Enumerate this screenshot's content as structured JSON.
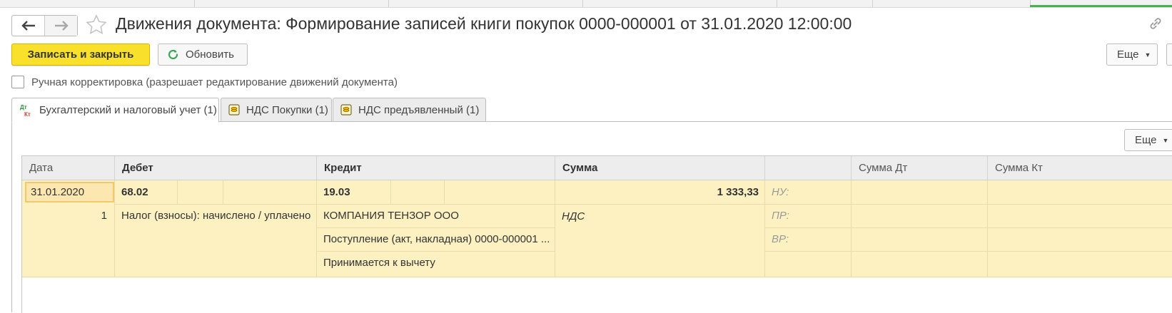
{
  "window": {
    "title": "Движения документа: Формирование записей книги покупок 0000-000001 от 31.01.2020 12:00:00"
  },
  "toolbar": {
    "save_close_label": "Записать и закрыть",
    "refresh_label": "Обновить",
    "more_label": "Еще"
  },
  "manual_edit": {
    "label": "Ручная корректировка (разрешает редактирование движений документа)",
    "checked": false
  },
  "tabs": [
    {
      "label": "Бухгалтерский и налоговый учет (1)",
      "icon": "dt-kt-icon",
      "active": true
    },
    {
      "label": "НДС Покупки (1)",
      "icon": "register-icon",
      "active": false
    },
    {
      "label": "НДС предъявленный (1)",
      "icon": "register-icon",
      "active": false
    }
  ],
  "table": {
    "more_label": "Еще",
    "columns": [
      "Дата",
      "Дебет",
      "Кредит",
      "Сумма",
      "",
      "Сумма Дт",
      "Сумма Кт"
    ],
    "row": {
      "date": "31.01.2020",
      "number": "1",
      "debit_account": "68.02",
      "debit_subconto1": "Налог (взносы): начислено / уплачено",
      "credit_account": "19.03",
      "credit_subconto1": "КОМПАНИЯ ТЕНЗОР ООО",
      "credit_subconto2": "Поступление (акт, накладная) 0000-000001 ...",
      "credit_subconto3": "Принимается к вычету",
      "amount": "1 333,33",
      "content": "НДС",
      "nu_label": "НУ:",
      "pr_label": "ПР:",
      "vr_label": "ВР:"
    }
  },
  "colors": {
    "primary_button": "#f9e02a",
    "row_highlight": "#fdf1c2",
    "refresh_icon": "#3aa657",
    "active_strip": "#4caf50"
  }
}
